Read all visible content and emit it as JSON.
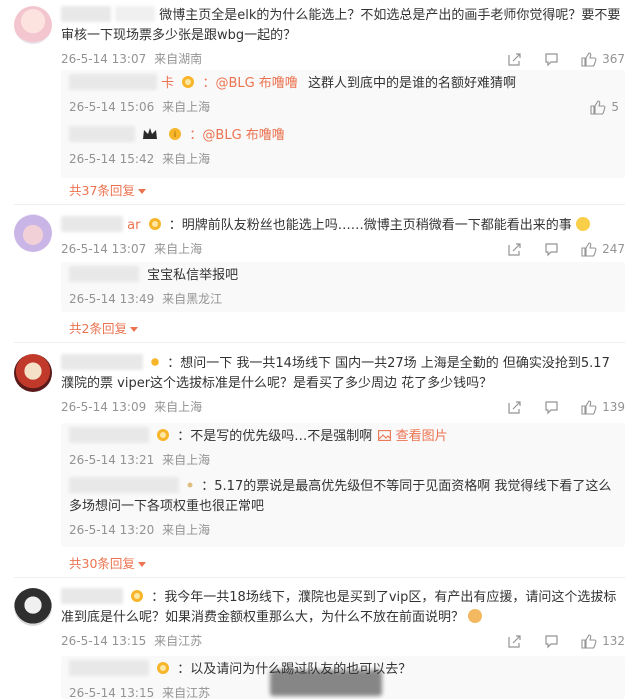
{
  "comments": [
    {
      "text": "微博主页全是elk的为什么能选上？不如选总是产出的画手老师你觉得呢？要不要审核一下现场票多少张是跟wbg一起的？",
      "time": "26-5-14 13:07",
      "location": "来自湖南",
      "likes": "367",
      "replies": [
        {
          "mention": "：@BLG 布噜噜",
          "text": "这群人到底中的是谁的名额好难猜啊",
          "time": "26-5-14 15:06",
          "location": "来自上海",
          "likes": "5",
          "name_tail": "卡"
        },
        {
          "mention": "：@BLG 布噜噜",
          "text": "",
          "time": "26-5-14 15:42",
          "location": "来自上海"
        }
      ],
      "more": "共37条回复"
    },
    {
      "name_tail": "ar",
      "text": "：明牌前队友粉丝也能选上吗……微博主页稍微看一下都能看出来的事",
      "time": "26-5-14 13:07",
      "location": "来自上海",
      "likes": "247",
      "replies": [
        {
          "text": "宝宝私信举报吧",
          "time": "26-5-14 13:49",
          "location": "来自黑龙江"
        }
      ],
      "more": "共2条回复"
    },
    {
      "text": "：想问一下 我一共14场线下 国内一共27场 上海是全勤的 但确实没抢到5.17濮院的票 viper这个选拔标准是什么呢？是看买了多少周边 花了多少钱吗？",
      "time": "26-5-14 13:09",
      "location": "来自上海",
      "likes": "139",
      "replies": [
        {
          "text": "：不是写的优先级吗…不是强制啊",
          "view_image": "查看图片",
          "time": "26-5-14 13:21",
          "location": "来自上海"
        },
        {
          "text": "：5.17的票说是最高优先级但不等同于见面资格啊 我觉得线下看了这么多场想问一下各项权重也很正常吧",
          "time": "26-5-14 13:20",
          "location": "来自上海"
        }
      ],
      "more": "共30条回复"
    },
    {
      "text": "：我今年一共18场线下，濮院也是买到了vip区，有产出有应援，请问这个选拔标准到底是什么呢？如果消费金额权重那么大，为什么不放在前面说明？",
      "time": "26-5-14 13:15",
      "location": "来自江苏",
      "likes": "132",
      "replies": [
        {
          "text": "：以及请问为什么踢过队友的也可以去？",
          "time": "26-5-14 13:15",
          "location": "来自江苏"
        }
      ]
    }
  ],
  "colors": {
    "accent": "#eb7350",
    "meta": "#939393",
    "reply_bg": "#f9f9f9"
  },
  "icons": [
    "share-icon",
    "comment-icon",
    "like-icon",
    "image-icon",
    "smile-emoji-icon",
    "vip-badge-icon",
    "crown-badge-icon"
  ]
}
